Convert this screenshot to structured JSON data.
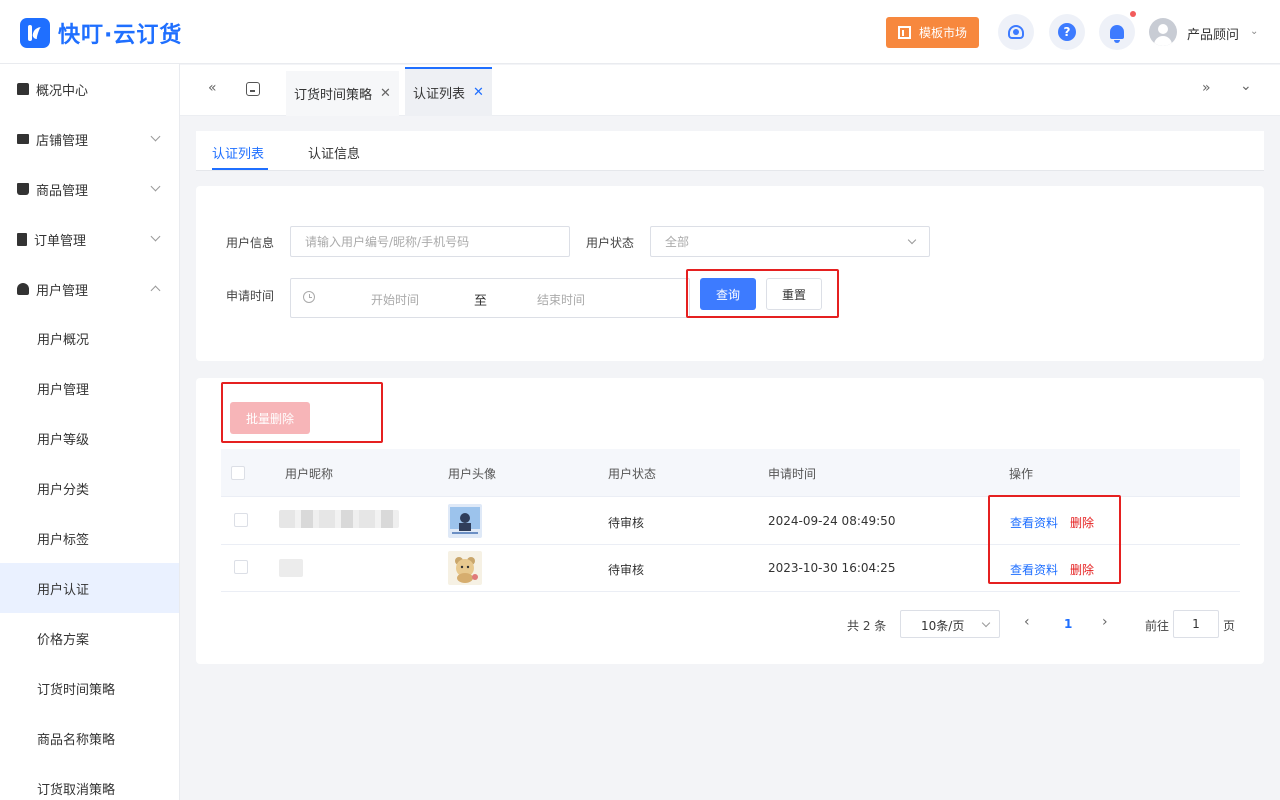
{
  "header": {
    "brand": "快叮·云订货",
    "template_market": "模板市场",
    "user_name": "产品顾问"
  },
  "sidebar": {
    "items": [
      {
        "label": "概况中心",
        "icon": "lock-icon"
      },
      {
        "label": "店铺管理",
        "icon": "store-icon"
      },
      {
        "label": "商品管理",
        "icon": "bag-icon"
      },
      {
        "label": "订单管理",
        "icon": "clipboard-icon"
      },
      {
        "label": "用户管理",
        "icon": "user-icon"
      }
    ],
    "sub_items": [
      "用户概况",
      "用户管理",
      "用户等级",
      "用户分类",
      "用户标签",
      "用户认证",
      "价格方案",
      "订货时间策略",
      "商品名称策略",
      "订货取消策略"
    ],
    "active_sub": "用户认证"
  },
  "tabs": [
    {
      "label": "订货时间策略",
      "active": false
    },
    {
      "label": "认证列表",
      "active": true
    }
  ],
  "subtabs": [
    {
      "label": "认证列表",
      "active": true
    },
    {
      "label": "认证信息",
      "active": false
    }
  ],
  "filters": {
    "user_info_label": "用户信息",
    "user_info_placeholder": "请输入用户编号/昵称/手机号码",
    "user_status_label": "用户状态",
    "user_status_value": "全部",
    "apply_time_label": "申请时间",
    "start_placeholder": "开始时间",
    "range_sep": "至",
    "end_placeholder": "结束时间",
    "query_button": "查询",
    "reset_button": "重置"
  },
  "batch_delete_button": "批量删除",
  "table": {
    "columns": [
      "用户昵称",
      "用户头像",
      "用户状态",
      "申请时间",
      "操作"
    ],
    "rows": [
      {
        "status": "待审核",
        "apply_time": "2024-09-24 08:49:50",
        "view": "查看资料",
        "delete": "删除"
      },
      {
        "status": "待审核",
        "apply_time": "2023-10-30 16:04:25",
        "view": "查看资料",
        "delete": "删除"
      }
    ]
  },
  "pagination": {
    "total": "共 2 条",
    "page_size": "10条/页",
    "current_page": "1",
    "goto_label": "前往",
    "goto_value": "1",
    "page_unit": "页"
  },
  "colors": {
    "primary": "#1f6fff",
    "danger": "#e52020",
    "orange": "#f7883e"
  }
}
